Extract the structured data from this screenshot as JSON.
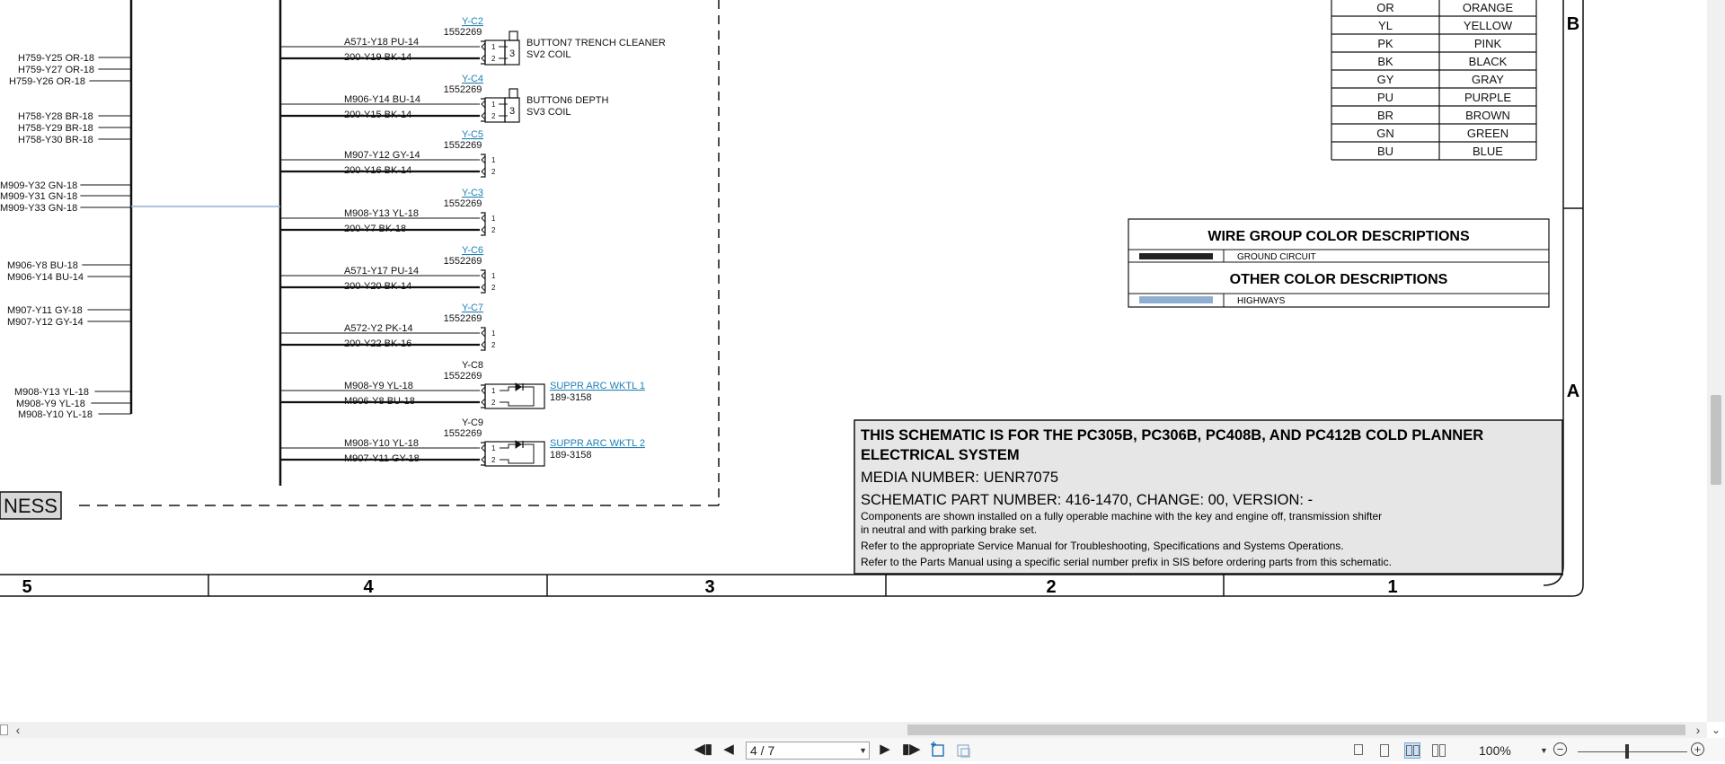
{
  "left_panel": {
    "wires": [
      "H759-Y25 OR-18",
      "H759-Y27 OR-18",
      "H759-Y26 OR-18",
      "H758-Y28 BR-18",
      "H758-Y29 BR-18",
      "H758-Y30 BR-18",
      "M909-Y32 GN-18",
      "M909-Y31 GN-18",
      "M909-Y33 GN-18",
      "M906-Y8 BU-18",
      "M906-Y14 BU-14",
      "M907-Y11 GY-18",
      "M907-Y12 GY-14",
      "M908-Y13 YL-18",
      "M908-Y9 YL-18",
      "M908-Y10 YL-18"
    ],
    "harness_label": "NESS"
  },
  "connectors": [
    {
      "id": "Y-C2",
      "part": "1552269",
      "linked": true,
      "wire1": "A571-Y18 PU-14",
      "wire2": "200-Y19 BK-14",
      "desc1": "BUTTON7 TRENCH CLEANER",
      "desc2": "SV2 COIL",
      "pin1": "1",
      "pin2": "2",
      "coil": "3",
      "type": "coil"
    },
    {
      "id": "Y-C4",
      "part": "1552269",
      "linked": true,
      "wire1": "M906-Y14 BU-14",
      "wire2": "200-Y15 BK-14",
      "desc1": "BUTTON6 DEPTH",
      "desc2": "SV3 COIL",
      "pin1": "1",
      "pin2": "2",
      "coil": "3",
      "type": "coil"
    },
    {
      "id": "Y-C5",
      "part": "1552269",
      "linked": true,
      "wire1": "M907-Y12 GY-14",
      "wire2": "200-Y16 BK-14",
      "pin1": "1",
      "pin2": "2",
      "type": "plain"
    },
    {
      "id": "Y-C3",
      "part": "1552269",
      "linked": true,
      "wire1": "M908-Y13 YL-18",
      "wire2": "200-Y7 BK-18",
      "pin1": "1",
      "pin2": "2",
      "type": "plain"
    },
    {
      "id": "Y-C6",
      "part": "1552269",
      "linked": true,
      "wire1": "A571-Y17 PU-14",
      "wire2": "200-Y20 BK-14",
      "pin1": "1",
      "pin2": "2",
      "type": "plain"
    },
    {
      "id": "Y-C7",
      "part": "1552269",
      "linked": true,
      "wire1": "A572-Y2 PK-14",
      "wire2": "200-Y22 BK-16",
      "pin1": "1",
      "pin2": "2",
      "type": "plain"
    },
    {
      "id": "Y-C8",
      "part": "1552269",
      "linked": false,
      "wire1": "M908-Y9 YL-18",
      "wire2": "M906-Y8 BU-18",
      "suppr": "SUPPR ARC WKTL 1",
      "suppr_part": "189-3158",
      "pin1": "1",
      "pin2": "2",
      "type": "suppr"
    },
    {
      "id": "Y-C9",
      "part": "1552269",
      "linked": false,
      "wire1": "M908-Y10 YL-18",
      "wire2": "M907-Y11 GY-18",
      "suppr": "SUPPR ARC WKTL 2",
      "suppr_part": "189-3158",
      "pin1": "1",
      "pin2": "2",
      "type": "suppr"
    }
  ],
  "color_table": [
    {
      "code": "OR",
      "name": "ORANGE"
    },
    {
      "code": "YL",
      "name": "YELLOW"
    },
    {
      "code": "PK",
      "name": "PINK"
    },
    {
      "code": "BK",
      "name": "BLACK"
    },
    {
      "code": "GY",
      "name": "GRAY"
    },
    {
      "code": "PU",
      "name": "PURPLE"
    },
    {
      "code": "BR",
      "name": "BROWN"
    },
    {
      "code": "GN",
      "name": "GREEN"
    },
    {
      "code": "BU",
      "name": "BLUE"
    }
  ],
  "wire_group": {
    "title": "WIRE GROUP COLOR DESCRIPTIONS",
    "item": "GROUND CIRCUIT"
  },
  "other_color": {
    "title": "OTHER COLOR DESCRIPTIONS",
    "item": "HIGHWAYS"
  },
  "zones": {
    "rows": [
      "B",
      "A"
    ],
    "columns": [
      "5",
      "4",
      "3",
      "2",
      "1"
    ]
  },
  "title_block": {
    "line1": "THIS SCHEMATIC IS FOR THE PC305B, PC306B, PC408B, AND PC412B COLD PLANNER",
    "line2": "ELECTRICAL SYSTEM",
    "media": "MEDIA NUMBER: UENR7075",
    "part": "SCHEMATIC PART NUMBER: 416-1470, CHANGE: 00, VERSION: -",
    "note1": "Components are shown installed on a fully operable machine with the key and engine off, transmission shifter",
    "note2": "in neutral and with parking brake set.",
    "note3": "Refer to the appropriate Service Manual for Troubleshooting, Specifications and Systems Operations.",
    "note4": "Refer to the Parts Manual using a specific serial number prefix in SIS before ordering parts from this schematic."
  },
  "toolbar": {
    "page": "4 / 7",
    "zoom": "100%"
  },
  "colors": {
    "highway": "#8fafd2",
    "link": "#1f7fb5",
    "ground": "#222222",
    "titlebg": "#e6e6e6"
  }
}
